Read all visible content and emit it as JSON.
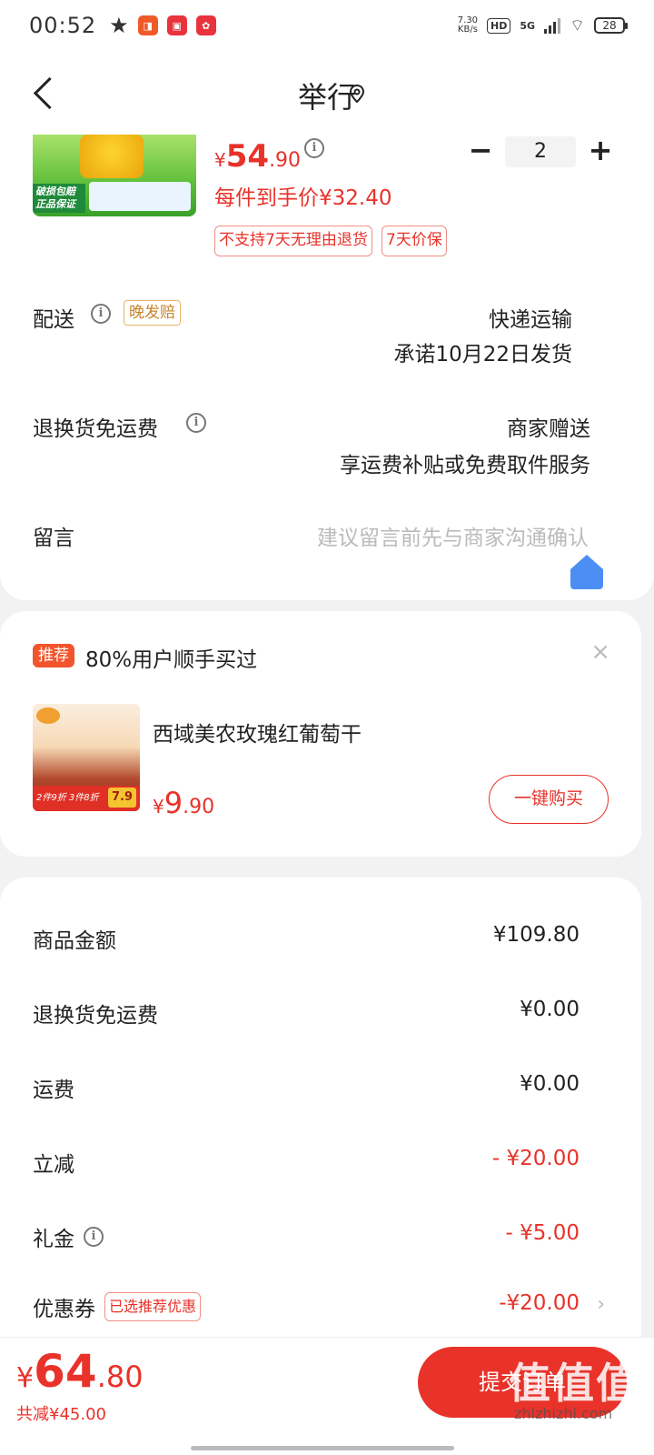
{
  "status_bar": {
    "time": "00:52",
    "net_speed_value": "7.30",
    "net_speed_unit": "KB/s",
    "hd": "HD",
    "network": "5G",
    "battery": "28",
    "app_icons": [
      "star-icon",
      "app-icon-1",
      "app-icon-2",
      "app-icon-3"
    ]
  },
  "header": {
    "title": "举行"
  },
  "product": {
    "image_badge": "破损包赔正品保证",
    "price_currency": "¥",
    "price_int": "54",
    "price_dec": ".90",
    "each_price_text": "每件到手价¥32.40",
    "tags": [
      "不支持7天无理由退货",
      "7天价保"
    ],
    "quantity": "2"
  },
  "shipping": {
    "label": "配送",
    "late_tag": "晚发赔",
    "method": "快递运输",
    "promise": "承诺10月22日发货"
  },
  "return_shipping": {
    "label": "退换货免运费",
    "value": "商家赠送",
    "detail": "享运费补贴或免费取件服务"
  },
  "message": {
    "label": "留言",
    "placeholder": "建议留言前先与商家沟通确认"
  },
  "recommend": {
    "tag": "推荐",
    "title": "80%用户顺手买过",
    "close": "×",
    "item_name": "西域美农玫瑰红葡萄干",
    "item_image_text": "2件9折 3件8折",
    "item_image_price": "7.9",
    "price_currency": "¥",
    "price_int": "9",
    "price_dec": ".90",
    "buy_button": "一键购买"
  },
  "summary": {
    "rows": [
      {
        "label": "商品金额",
        "value": "¥109.80"
      },
      {
        "label": "退换货免运费",
        "value": "¥0.00"
      },
      {
        "label": "运费",
        "value": "¥0.00"
      },
      {
        "label": "立减",
        "value": "- ¥20.00"
      },
      {
        "label": "礼金",
        "value": "- ¥5.00"
      },
      {
        "label": "优惠券",
        "value": "-¥20.00",
        "tag": "已选推荐优惠"
      }
    ]
  },
  "bottom": {
    "currency": "¥",
    "total_int": "64",
    "total_dec": ".80",
    "saved": "共减¥45.00",
    "submit": "提交订单",
    "watermark": "值值值",
    "watermark_url": "zhizhizhi.com"
  },
  "colors": {
    "accent": "#e8322a",
    "background": "#f2f2f2",
    "card": "#ffffff"
  }
}
